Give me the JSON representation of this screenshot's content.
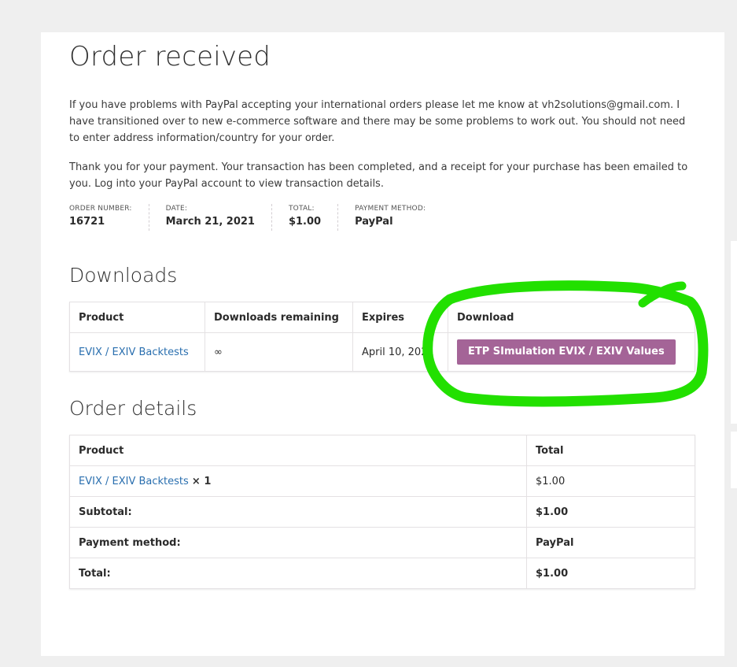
{
  "page": {
    "title": "Order received",
    "notice": "If you have problems with PayPal accepting your international orders please let me know at vh2solutions@gmail.com.  I have transitioned over to new e-commerce software and there may be some problems to work out.  You should not need to enter address information/country for your order.",
    "thanks": "Thank you for your payment. Your transaction has been completed, and a receipt for your purchase has been emailed to you. Log into your PayPal account to view transaction details."
  },
  "overview": {
    "order_number_label": "ORDER NUMBER:",
    "order_number": "16721",
    "date_label": "DATE:",
    "date": "March 21, 2021",
    "total_label": "TOTAL:",
    "total": "$1.00",
    "payment_label": "PAYMENT METHOD:",
    "payment": "PayPal"
  },
  "downloads": {
    "title": "Downloads",
    "headers": [
      "Product",
      "Downloads remaining",
      "Expires",
      "Download"
    ],
    "row": {
      "product": "EVIX / EXIV Backtests",
      "remaining": "∞",
      "expires": "April 10, 2021",
      "button": "ETP SImulation EVIX / EXIV Values"
    }
  },
  "details": {
    "title": "Order details",
    "headers": [
      "Product",
      "Total"
    ],
    "item": {
      "product": "EVIX / EXIV Backtests",
      "qty": "× 1",
      "total": "$1.00"
    },
    "subtotal_label": "Subtotal:",
    "subtotal": "$1.00",
    "payment_label": "Payment method:",
    "payment": "PayPal",
    "total_label": "Total:",
    "total": "$1.00"
  },
  "colors": {
    "accent": "#a46497",
    "link": "#2a6faf",
    "highlight": "#22e000"
  }
}
